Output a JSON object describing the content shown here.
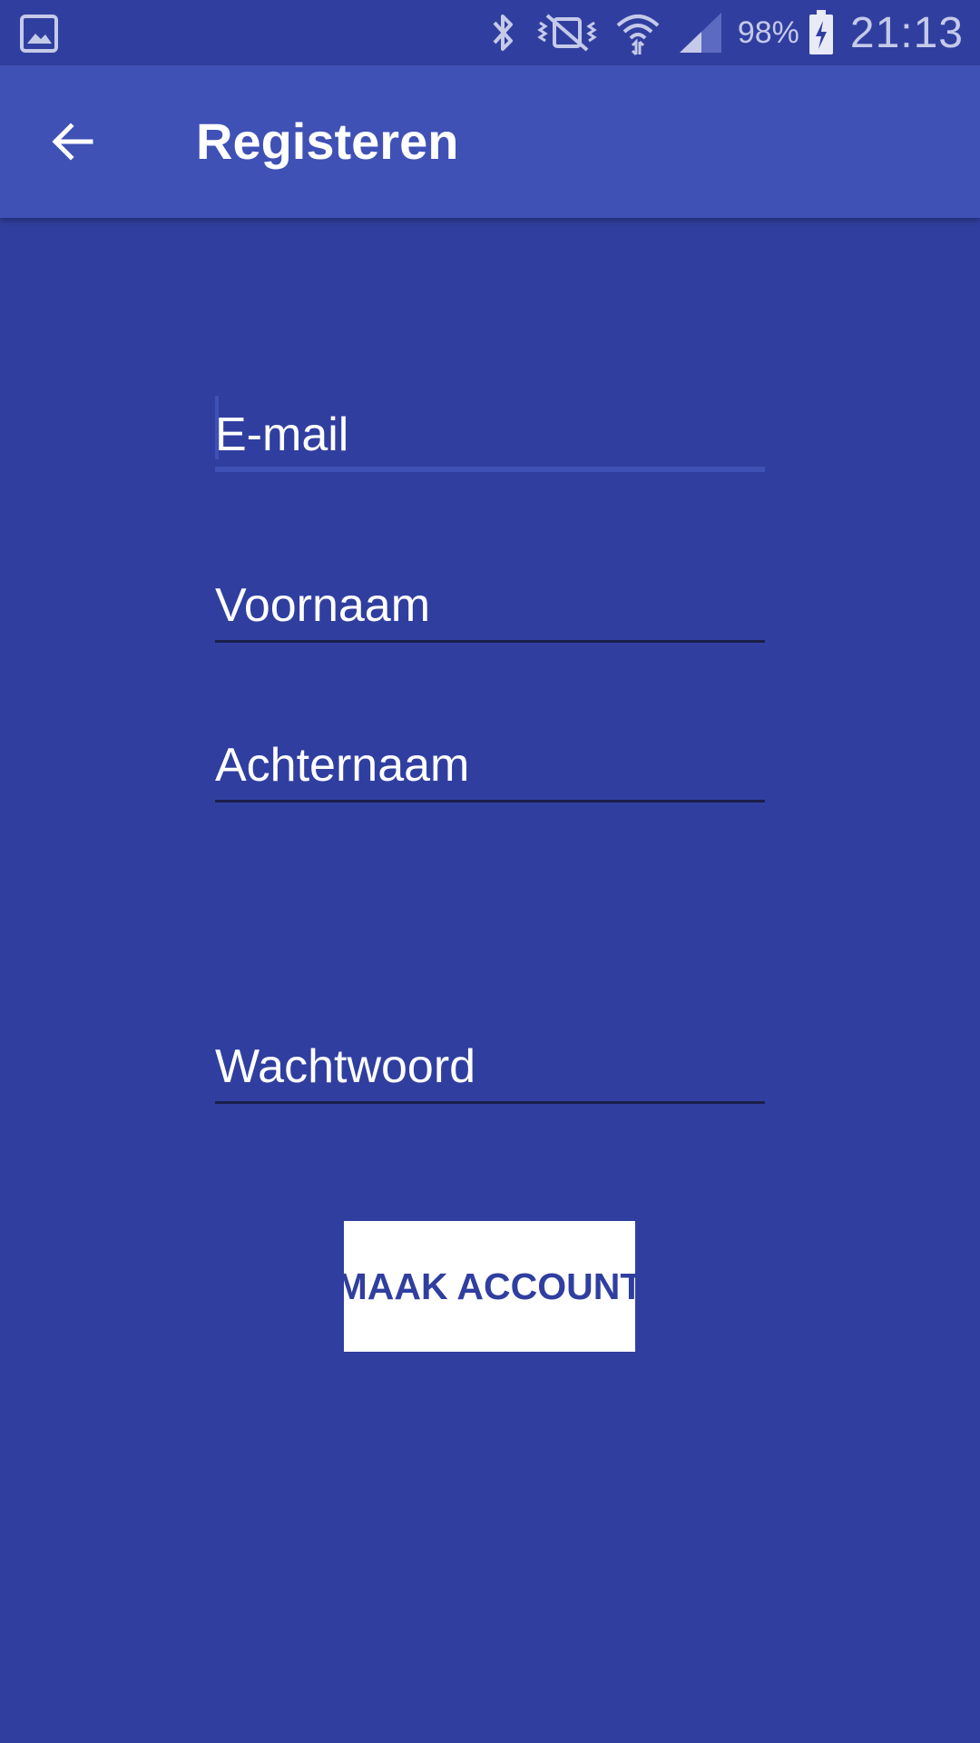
{
  "status_bar": {
    "left_icon": "gallery-icon",
    "icons": [
      "bluetooth-icon",
      "vibrate-off-icon",
      "wifi-icon",
      "cell-signal-icon"
    ],
    "battery_percent": "98%",
    "time": "21:13"
  },
  "toolbar": {
    "back_icon": "arrow-back-icon",
    "title": "Registeren"
  },
  "form": {
    "email_placeholder": "E-mail",
    "first_name_placeholder": "Voornaam",
    "last_name_placeholder": "Achternaam",
    "password_placeholder": "Wachtwoord",
    "submit_label": "MAAK ACCOUNT"
  },
  "colors": {
    "background": "#303F9F",
    "toolbar": "#3F51B5",
    "button_bg": "#FFFFFF",
    "button_text": "#303F9F"
  }
}
